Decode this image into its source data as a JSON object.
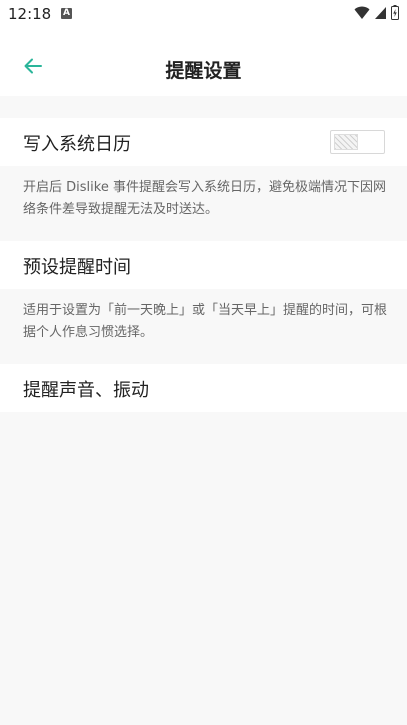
{
  "status_bar": {
    "time": "12:18",
    "notification_badge": "A",
    "icons": [
      "wifi-icon",
      "signal-icon",
      "battery-icon"
    ]
  },
  "header": {
    "title": "提醒设置",
    "back_icon": "arrow-left-icon"
  },
  "settings": {
    "calendar": {
      "label": "写入系统日历",
      "toggle_state": "off",
      "description": "开启后 Dislike 事件提醒会写入系统日历，避免极端情况下因网络条件差导致提醒无法及时送达。"
    },
    "preset_time": {
      "label": "预设提醒时间",
      "description": "适用于设置为「前一天晚上」或「当天早上」提醒的时间，可根据个人作息习惯选择。"
    },
    "sound_vibration": {
      "label": "提醒声音、振动"
    }
  },
  "colors": {
    "accent": "#2bb59a",
    "background": "#f8f8f8",
    "surface": "#ffffff",
    "text_primary": "#222222",
    "text_secondary": "#666666"
  }
}
